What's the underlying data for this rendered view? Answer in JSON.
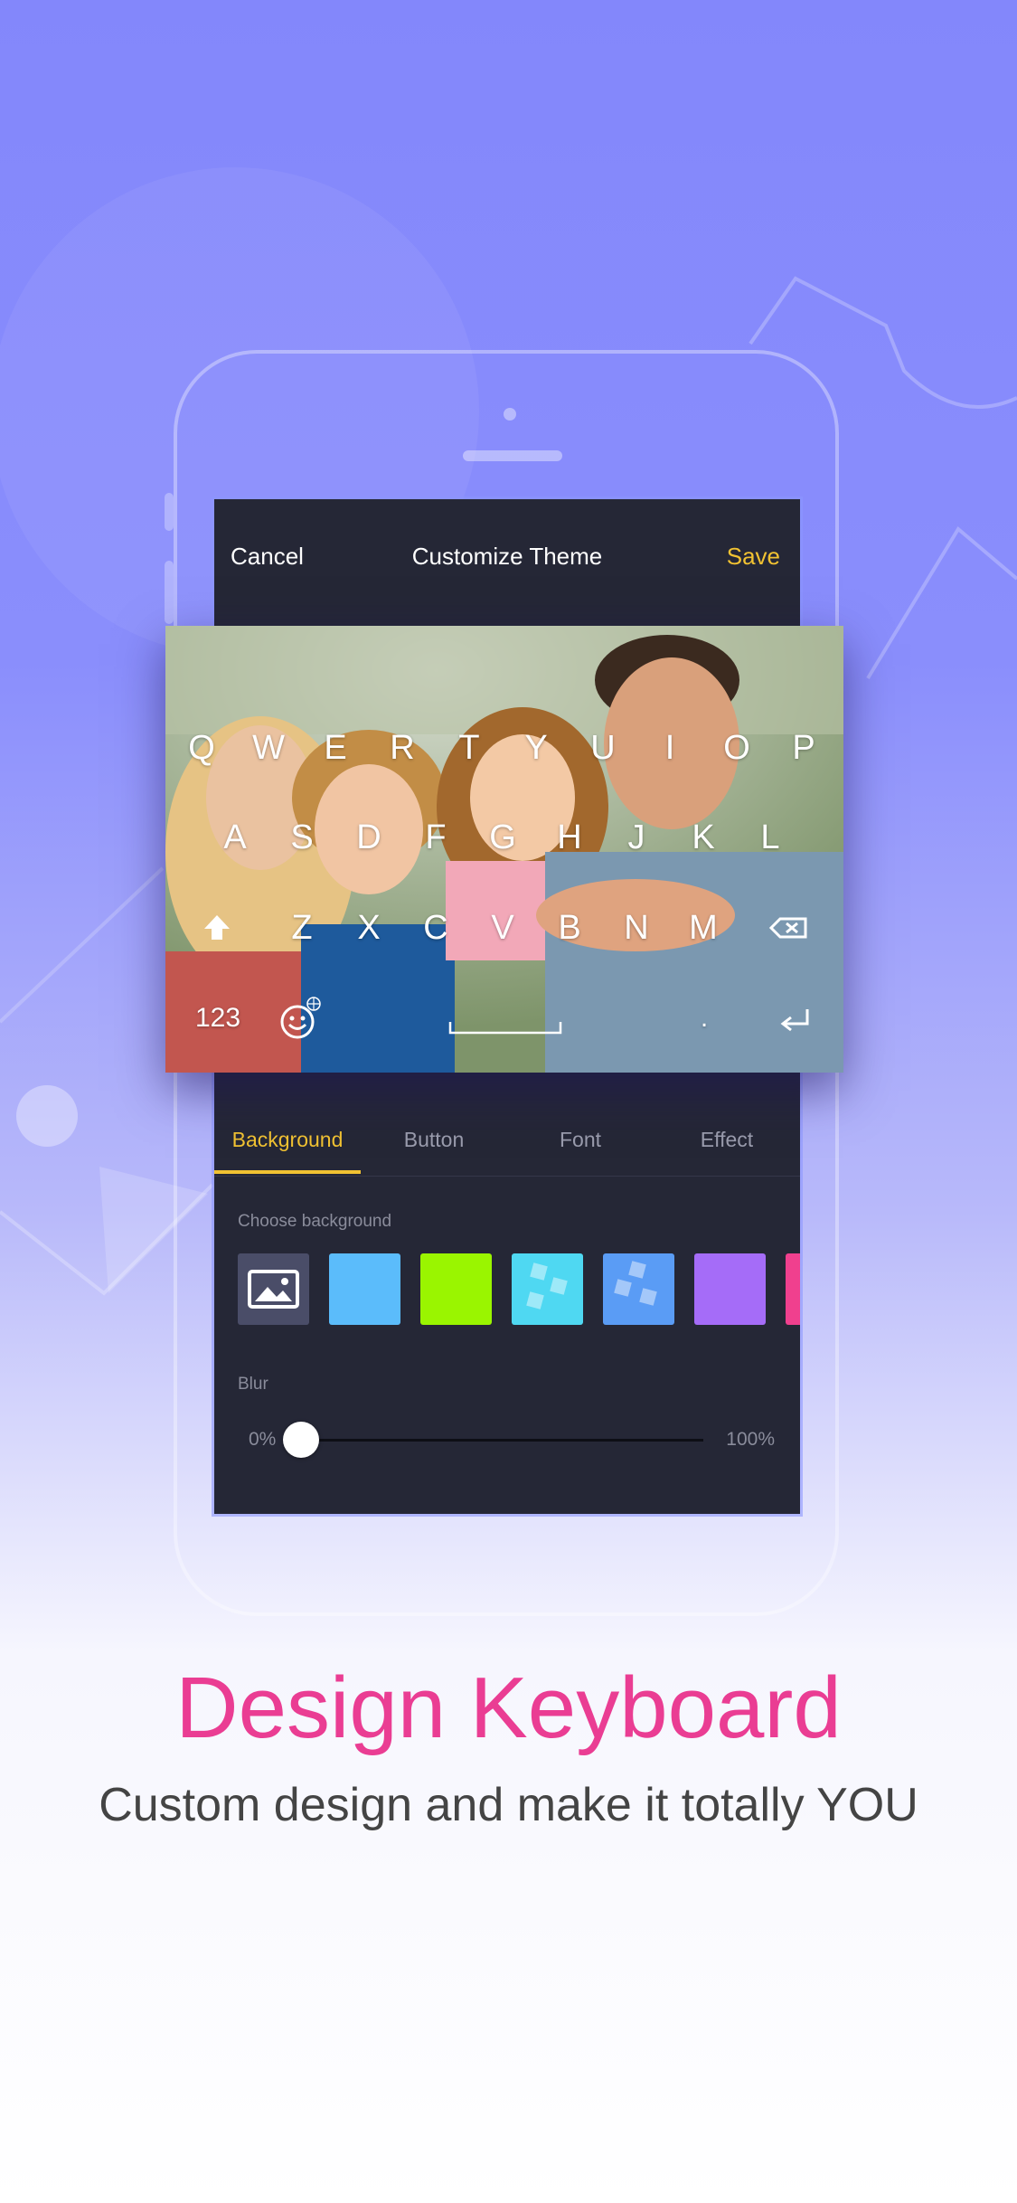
{
  "nav": {
    "cancel_label": "Cancel",
    "title": "Customize Theme",
    "save_label": "Save"
  },
  "keyboard": {
    "row1": [
      "Q",
      "W",
      "E",
      "R",
      "T",
      "Y",
      "U",
      "I",
      "O",
      "P"
    ],
    "row2": [
      "A",
      "S",
      "D",
      "F",
      "G",
      "H",
      "J",
      "K",
      "L"
    ],
    "row3": [
      "Z",
      "X",
      "C",
      "V",
      "B",
      "N",
      "M"
    ],
    "numbers_key": "123",
    "period_key": ".",
    "icons": [
      "shift-icon",
      "backspace-icon",
      "emoji-icon",
      "globe-icon",
      "space-bar",
      "return-icon"
    ]
  },
  "tabs": [
    {
      "label": "Background",
      "active": true
    },
    {
      "label": "Button",
      "active": false
    },
    {
      "label": "Font",
      "active": false
    },
    {
      "label": "Effect",
      "active": false
    }
  ],
  "background_section": {
    "label": "Choose background",
    "swatches": [
      {
        "name": "photo-picker",
        "color": "#4a4d68",
        "icon": "image-icon"
      },
      {
        "name": "sky-blue",
        "color": "#5bbcfb"
      },
      {
        "name": "lime-green",
        "color": "#9af500"
      },
      {
        "name": "cyan-pattern",
        "color": "#4fd8f2"
      },
      {
        "name": "blue-pattern",
        "color": "#5a9cf5"
      },
      {
        "name": "purple",
        "color": "#a56cf8"
      },
      {
        "name": "pink",
        "color": "#f0408e"
      }
    ]
  },
  "blur": {
    "label": "Blur",
    "min_label": "0%",
    "max_label": "100%",
    "value_percent": 0
  },
  "marketing": {
    "headline": "Design Keyboard",
    "subline": "Custom design and make it totally YOU"
  },
  "colors": {
    "accent": "#f1c232",
    "headline": "#ea3d93",
    "panel": "#252736"
  }
}
